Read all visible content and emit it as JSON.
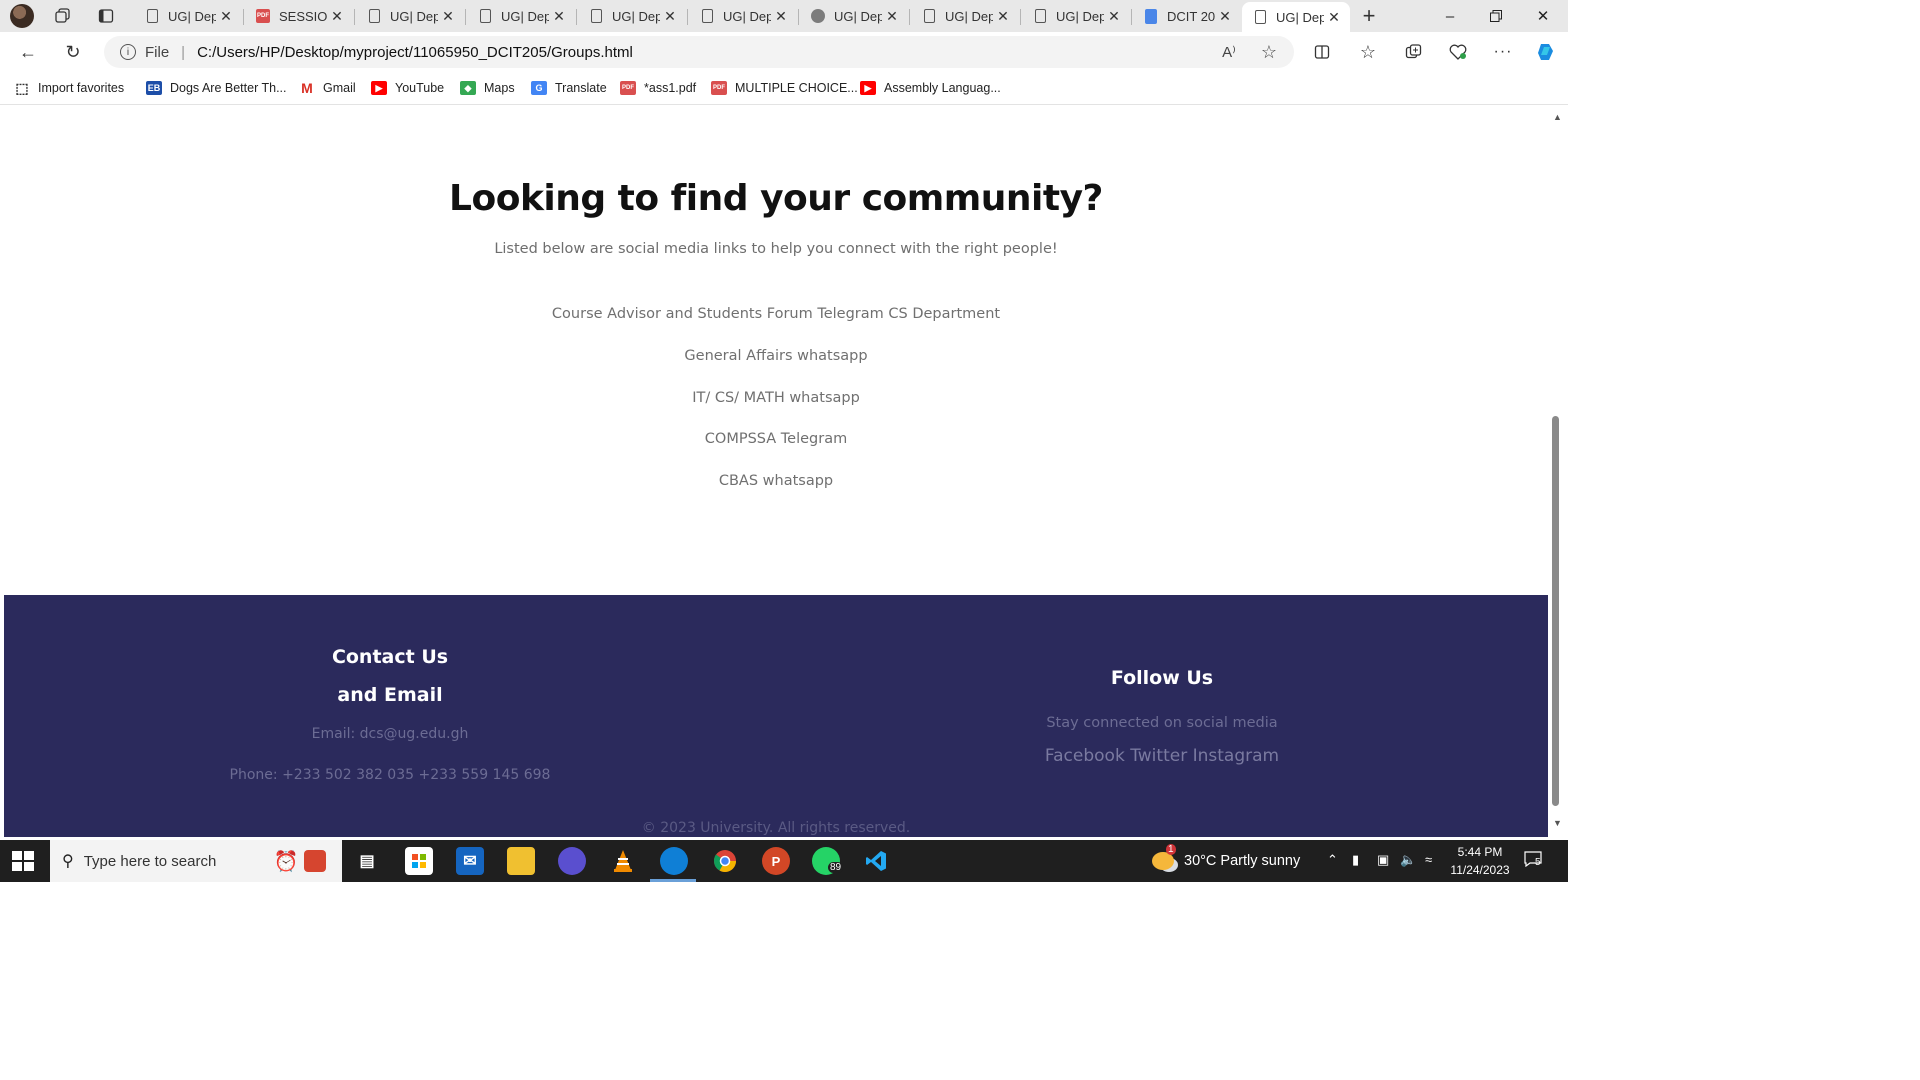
{
  "browser": {
    "tabs": [
      {
        "title": "UG| Dep",
        "icon": "document-icon"
      },
      {
        "title": "SESSION",
        "icon": "pdf-icon"
      },
      {
        "title": "UG| Dep",
        "icon": "document-icon"
      },
      {
        "title": "UG| Dep",
        "icon": "document-icon"
      },
      {
        "title": "UG| Dep",
        "icon": "document-icon"
      },
      {
        "title": "UG| Dep",
        "icon": "document-icon"
      },
      {
        "title": "UG| Dep",
        "icon": "globe-gray-icon"
      },
      {
        "title": "UG| Dep",
        "icon": "document-icon"
      },
      {
        "title": "UG| Dep",
        "icon": "document-icon"
      },
      {
        "title": "DCIT 20",
        "icon": "google-docs-icon"
      },
      {
        "title": "UG| Dep",
        "icon": "document-icon",
        "active": true
      }
    ],
    "address": {
      "scheme_label": "File",
      "url": "C:/Users/HP/Desktop/myproject/11065950_DCIT205/Groups.html"
    },
    "bookmarks": [
      {
        "label": "Import favorites",
        "icon": "import-icon"
      },
      {
        "label": "Dogs Are Better Th...",
        "icon": "eb-icon"
      },
      {
        "label": "Gmail",
        "icon": "gmail-icon"
      },
      {
        "label": "YouTube",
        "icon": "youtube-icon"
      },
      {
        "label": "Maps",
        "icon": "maps-icon"
      },
      {
        "label": "Translate",
        "icon": "translate-icon"
      },
      {
        "label": "*ass1.pdf",
        "icon": "pdf-icon"
      },
      {
        "label": "MULTIPLE CHOICE...",
        "icon": "pdf-icon"
      },
      {
        "label": "Assembly Languag...",
        "icon": "youtube-icon"
      }
    ]
  },
  "page": {
    "title": "Looking to find your community?",
    "subtitle": "Listed below are social media links to help you connect with the right people!",
    "groups": [
      "Course Advisor and Students Forum Telegram CS Department",
      "General Affairs whatsapp",
      "IT/ CS/ MATH whatsapp",
      "COMPSSA Telegram",
      "CBAS whatsapp"
    ],
    "footer": {
      "contact_title_line1": "Contact Us",
      "contact_title_line2": "and Email",
      "email": "Email: dcs@ug.edu.gh",
      "phone": "Phone: +233 502 382 035 +233 559 145 698",
      "follow_title": "Follow Us",
      "follow_text": "Stay connected on social media",
      "social_links": [
        "Facebook",
        "Twitter",
        "Instagram"
      ],
      "copyright": "© 2023 University. All rights reserved."
    },
    "colors": {
      "footer_bg": "#2b2a5c",
      "title": "#111111",
      "link": "#707070"
    }
  },
  "taskbar": {
    "search_placeholder": "Type here to search",
    "apps": [
      "alarm-clock-icon",
      "gift-icon",
      "task-view-icon",
      "microsoft-store-icon",
      "mail-icon",
      "file-explorer-icon",
      "clipchamp-icon",
      "vlc-icon",
      "edge-icon",
      "chrome-icon",
      "powerpoint-icon",
      "whatsapp-icon",
      "vscode-icon"
    ],
    "whatsapp_badge": "89",
    "weather_badge": "1",
    "weather": "30°C  Partly sunny",
    "time": "5:44 PM",
    "date": "11/24/2023",
    "notifications": "5"
  }
}
